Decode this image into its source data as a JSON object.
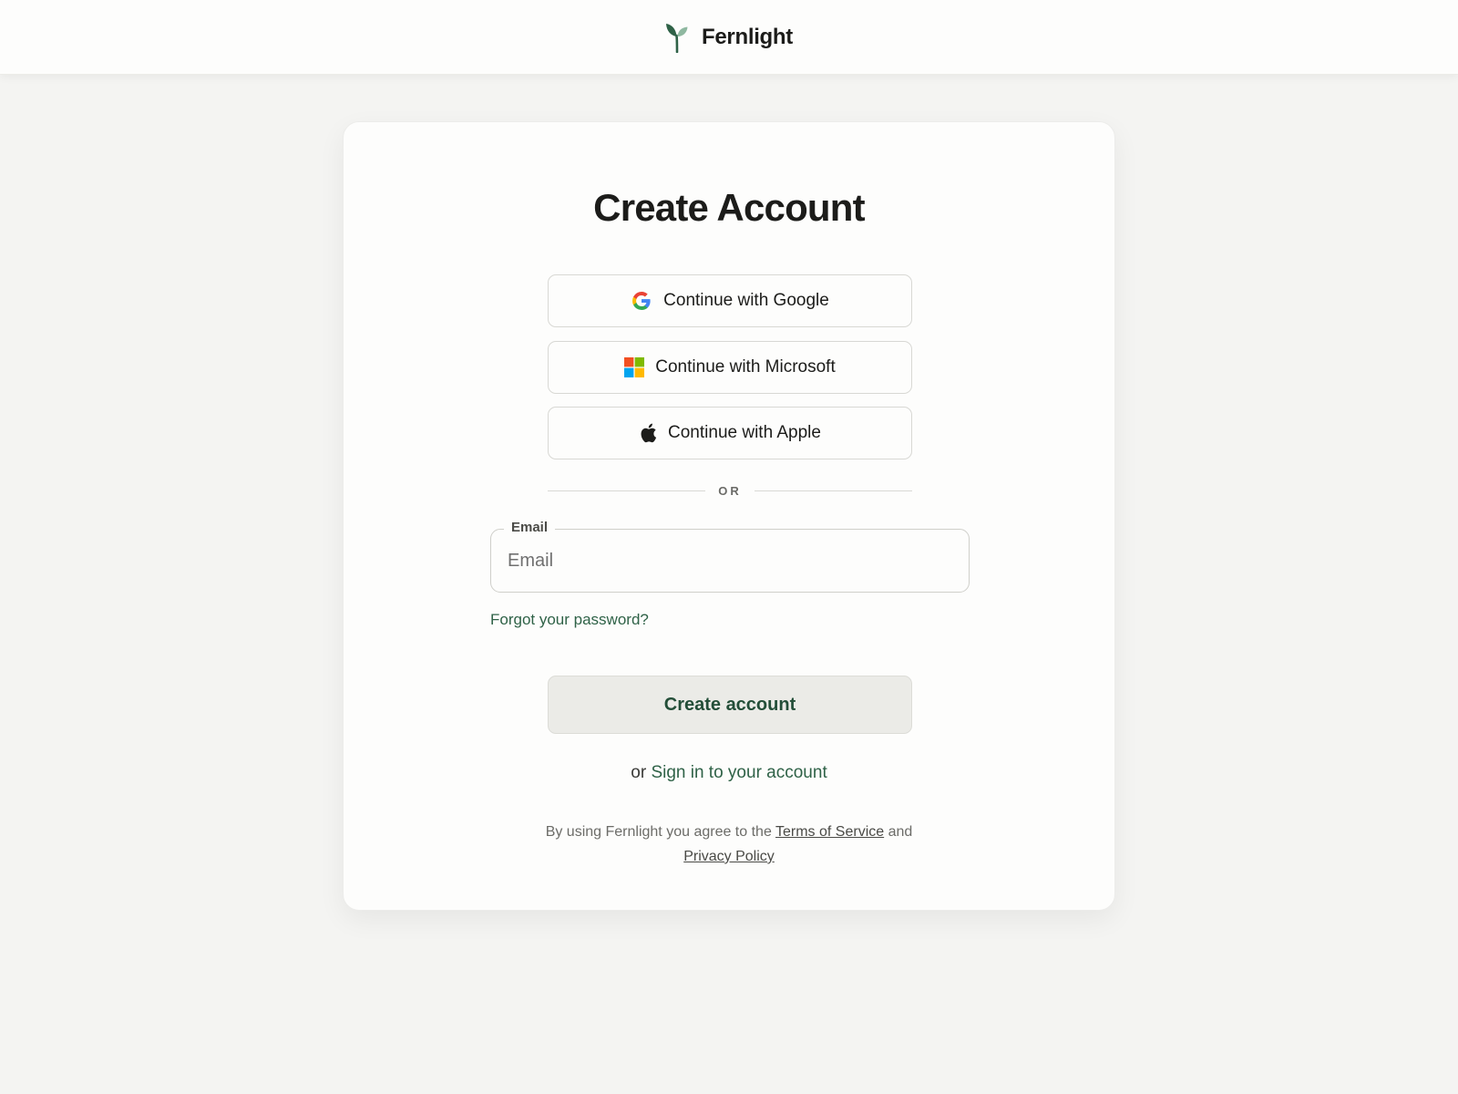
{
  "header": {
    "brand_name": "Fernlight",
    "logo_icon": "sprout-icon",
    "brand_color": "#2f6247"
  },
  "card": {
    "title": "Create Account",
    "sso": [
      {
        "label": "Continue with Google",
        "icon": "google-icon"
      },
      {
        "label": "Continue with Microsoft",
        "icon": "microsoft-icon"
      },
      {
        "label": "Continue with Apple",
        "icon": "apple-icon"
      }
    ],
    "divider_text": "OR",
    "email": {
      "label": "Email",
      "placeholder": "Email",
      "value": ""
    },
    "forgot_password": "Forgot your password?",
    "primary_button": "Create account",
    "signin": {
      "prefix": "or",
      "link": "Sign in to your account"
    },
    "legal": {
      "prefix": "By using Fernlight you agree to the",
      "terms": "Terms of Service",
      "conjunction": "and",
      "privacy": "Privacy Policy"
    }
  },
  "colors": {
    "background": "#f4f4f2",
    "accent": "#2f6247",
    "primary_button_bg": "#ebebe7",
    "primary_button_text": "#234e38"
  }
}
